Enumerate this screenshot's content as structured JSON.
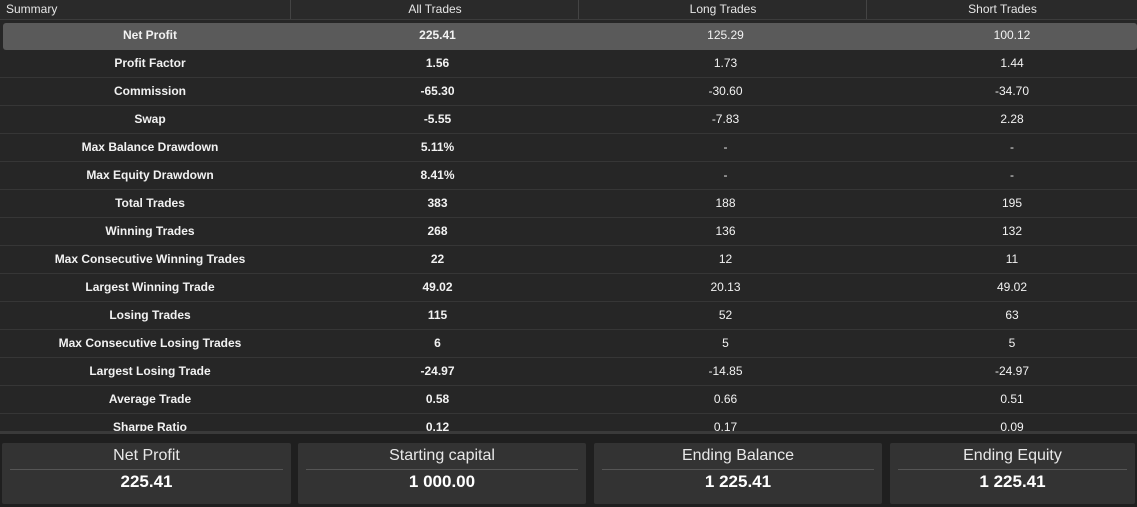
{
  "header": {
    "summary": "Summary",
    "all_trades": "All Trades",
    "long_trades": "Long Trades",
    "short_trades": "Short Trades"
  },
  "rows": [
    {
      "label": "Net Profit",
      "all": "225.41",
      "long": "125.29",
      "short": "100.12"
    },
    {
      "label": "Profit Factor",
      "all": "1.56",
      "long": "1.73",
      "short": "1.44"
    },
    {
      "label": "Commission",
      "all": "-65.30",
      "long": "-30.60",
      "short": "-34.70"
    },
    {
      "label": "Swap",
      "all": "-5.55",
      "long": "-7.83",
      "short": "2.28"
    },
    {
      "label": "Max Balance Drawdown",
      "all": "5.11%",
      "long": "-",
      "short": "-"
    },
    {
      "label": "Max Equity Drawdown",
      "all": "8.41%",
      "long": "-",
      "short": "-"
    },
    {
      "label": "Total Trades",
      "all": "383",
      "long": "188",
      "short": "195"
    },
    {
      "label": "Winning Trades",
      "all": "268",
      "long": "136",
      "short": "132"
    },
    {
      "label": "Max Consecutive Winning Trades",
      "all": "22",
      "long": "12",
      "short": "11"
    },
    {
      "label": "Largest Winning Trade",
      "all": "49.02",
      "long": "20.13",
      "short": "49.02"
    },
    {
      "label": "Losing Trades",
      "all": "115",
      "long": "52",
      "short": "63"
    },
    {
      "label": "Max Consecutive Losing Trades",
      "all": "6",
      "long": "5",
      "short": "5"
    },
    {
      "label": "Largest Losing Trade",
      "all": "-24.97",
      "long": "-14.85",
      "short": "-24.97"
    },
    {
      "label": "Average Trade",
      "all": "0.58",
      "long": "0.66",
      "short": "0.51"
    },
    {
      "label": "Sharpe Ratio",
      "all": "0.12",
      "long": "0.17",
      "short": "0.09"
    }
  ],
  "cards": [
    {
      "label": "Net Profit",
      "value": "225.41"
    },
    {
      "label": "Starting capital",
      "value": "1 000.00"
    },
    {
      "label": "Ending Balance",
      "value": "1 225.41"
    },
    {
      "label": "Ending Equity",
      "value": "1 225.41"
    }
  ],
  "colors": {
    "background": "#262626",
    "selected_row": "#5a5a5a",
    "card": "#333333",
    "text": "#f2f2f2"
  }
}
